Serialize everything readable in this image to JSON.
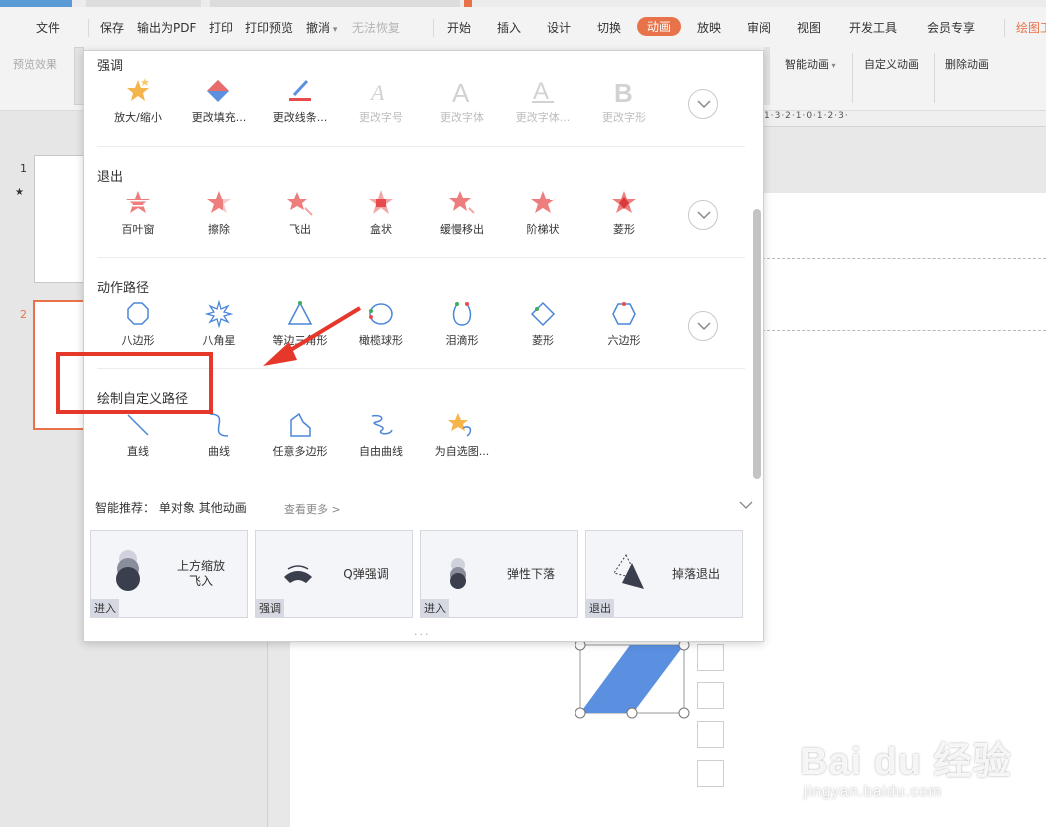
{
  "menubar": {
    "file": "文件",
    "quick": [
      "保存",
      "输出为PDF",
      "打印",
      "打印预览",
      "撤消",
      "无法恢复"
    ],
    "tabs": [
      "开始",
      "插入",
      "设计",
      "切换",
      "动画",
      "放映",
      "审阅",
      "视图",
      "开发工具",
      "会员专享",
      "绘图工"
    ],
    "active_tab": "动画"
  },
  "ribbon": {
    "preview": "预览效果",
    "smart_anim": "智能动画",
    "custom_anim": "自定义动画",
    "delete_anim": "删除动画"
  },
  "thumbs": {
    "n1": "1",
    "n2": "2",
    "star": "★"
  },
  "ruler": {
    "text": "1·3·2·1·0·1·2·3·"
  },
  "panel": {
    "sections": [
      {
        "title": "强调",
        "items": [
          "放大/缩小",
          "更改填充...",
          "更改线条...",
          "更改字号",
          "更改字体",
          "更改字体...",
          "更改字形"
        ]
      },
      {
        "title": "退出",
        "items": [
          "百叶窗",
          "擦除",
          "飞出",
          "盒状",
          "缓慢移出",
          "阶梯状",
          "菱形"
        ]
      },
      {
        "title": "动作路径",
        "items": [
          "八边形",
          "八角星",
          "等边三角形",
          "橄榄球形",
          "泪滴形",
          "菱形",
          "六边形"
        ]
      },
      {
        "title": "绘制自定义路径",
        "items": [
          "直线",
          "曲线",
          "任意多边形",
          "自由曲线",
          "为自选图..."
        ]
      }
    ],
    "smart_label": "智能推荐：",
    "smart_obj": "单对象",
    "smart_other": "其他动画",
    "see_more": "查看更多 >",
    "cards": [
      {
        "label1": "上方缩放",
        "label2": "飞入",
        "tag": "进入"
      },
      {
        "label1": "Q弹强调",
        "label2": "",
        "tag": "强调"
      },
      {
        "label1": "弹性下落",
        "label2": "",
        "tag": "进入"
      },
      {
        "label1": "掉落退出",
        "label2": "",
        "tag": "退出"
      }
    ],
    "more_dots": "···"
  },
  "watermark": {
    "main": "Bai du 经验",
    "sub": "jingyan.baidu.com"
  },
  "colors": {
    "accent": "#e8734a",
    "highlight": "#e6372b",
    "shape_fill": "#5b8fe0"
  }
}
